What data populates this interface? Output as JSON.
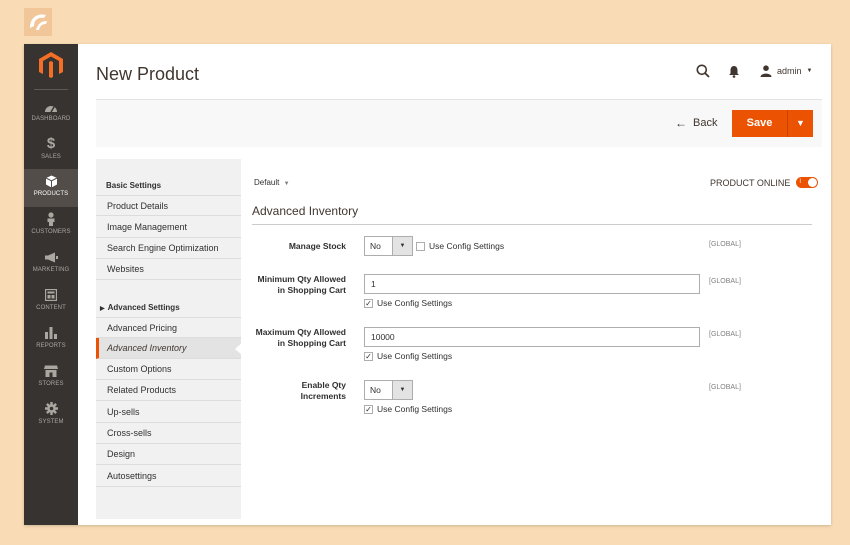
{
  "sidebar": {
    "items": [
      {
        "label": "DASHBOARD",
        "icon": "dashboard-icon"
      },
      {
        "label": "SALES",
        "icon": "dollar-icon"
      },
      {
        "label": "PRODUCTS",
        "icon": "cube-icon"
      },
      {
        "label": "CUSTOMERS",
        "icon": "person-icon"
      },
      {
        "label": "MARKETING",
        "icon": "megaphone-icon"
      },
      {
        "label": "CONTENT",
        "icon": "layout-icon"
      },
      {
        "label": "REPORTS",
        "icon": "bar-chart-icon"
      },
      {
        "label": "STORES",
        "icon": "store-icon"
      },
      {
        "label": "SYSTEM",
        "icon": "gear-icon"
      }
    ],
    "active": "PRODUCTS"
  },
  "header": {
    "title": "New Product",
    "user": "admin"
  },
  "actions": {
    "back_label": "Back",
    "save_label": "Save"
  },
  "tabs": {
    "basic_heading": "Basic Settings",
    "basic_items": [
      "Product Details",
      "Image Management",
      "Search Engine Optimization",
      "Websites"
    ],
    "advanced_heading": "Advanced Settings",
    "advanced_items": [
      "Advanced Pricing",
      "Advanced Inventory",
      "Custom Options",
      "Related Products",
      "Up-sells",
      "Cross-sells",
      "Design",
      "Autosettings"
    ],
    "active": "Advanced Inventory"
  },
  "main": {
    "scope": "Default",
    "online_label": "PRODUCT ONLINE",
    "online_toggle": "I",
    "online": true,
    "section_title": "Advanced Inventory",
    "fields": {
      "manage_stock": {
        "label": "Manage Stock",
        "value": "No",
        "use_config": false,
        "use_config_label": "Use Config Settings",
        "scope": "[GLOBAL]"
      },
      "min_qty": {
        "label_line1": "Minimum Qty Allowed",
        "label_line2": "in Shopping Cart",
        "value": "1",
        "use_config": true,
        "use_config_label": "Use Config Settings",
        "scope": "[GLOBAL]"
      },
      "max_qty": {
        "label_line1": "Maximum Qty Allowed",
        "label_line2": "in Shopping Cart",
        "value": "10000",
        "use_config": true,
        "use_config_label": "Use Config Settings",
        "scope": "[GLOBAL]"
      },
      "qty_increments": {
        "label_line1": "Enable Qty",
        "label_line2": "Increments",
        "value": "No",
        "use_config": true,
        "use_config_label": "Use Config Settings",
        "scope": "[GLOBAL]"
      }
    }
  },
  "colors": {
    "accent": "#eb5202",
    "sidebar_bg": "#373330",
    "page_bg": "#f9dcb5"
  }
}
